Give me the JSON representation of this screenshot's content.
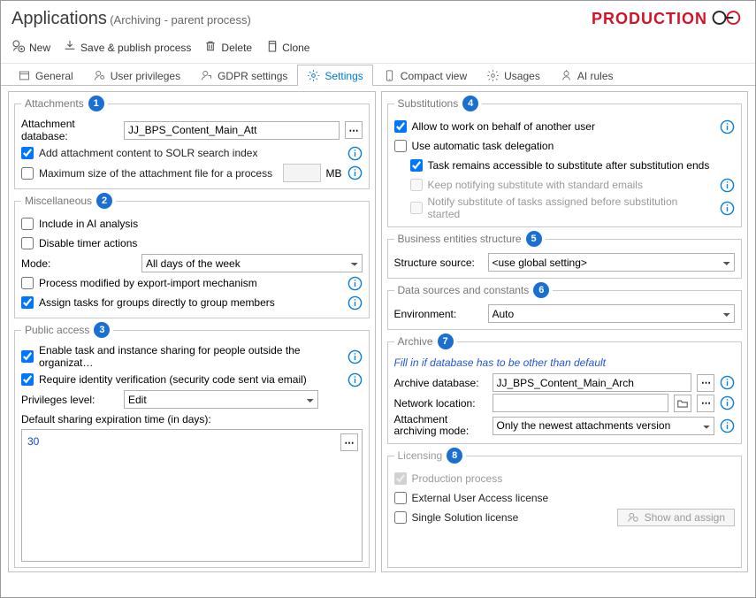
{
  "header": {
    "title": "Applications",
    "subtitle": "(Archiving - parent process)",
    "brand": "PRODUCTION"
  },
  "toolbar": {
    "new": "New",
    "save": "Save & publish process",
    "delete": "Delete",
    "clone": "Clone"
  },
  "tabs": {
    "general": "General",
    "user_priv": "User privileges",
    "gdpr": "GDPR settings",
    "settings": "Settings",
    "compact": "Compact view",
    "usages": "Usages",
    "ai": "AI rules"
  },
  "attachments": {
    "legend": "Attachments",
    "db_label": "Attachment database:",
    "db_value": "JJ_BPS_Content_Main_Att",
    "solr": "Add attachment content to SOLR search index",
    "maxsize": "Maximum size of the attachment file for a process",
    "mb": "MB"
  },
  "misc": {
    "legend": "Miscellaneous",
    "ai": "Include in AI analysis",
    "disable_timer": "Disable timer actions",
    "mode_label": "Mode:",
    "mode_value": "All days of the week",
    "export_import": "Process modified by export-import mechanism",
    "assign_groups": "Assign tasks for groups directly to group members"
  },
  "public": {
    "legend": "Public access",
    "enable_sharing": "Enable task and instance sharing for people outside the organizat…",
    "require_identity": "Require identity verification (security code sent via email)",
    "priv_label": "Privileges level:",
    "priv_value": "Edit",
    "exp_label": "Default sharing expiration time (in days):",
    "exp_value": "30"
  },
  "subs": {
    "legend": "Substitutions",
    "allow": "Allow to work on behalf of another user",
    "auto": "Use automatic task delegation",
    "remains": "Task remains accessible to substitute after substitution ends",
    "keep": "Keep notifying substitute with standard emails",
    "notify": "Notify substitute of tasks assigned before substitution started"
  },
  "bes": {
    "legend": "Business entities structure",
    "src_label": "Structure source:",
    "src_value": "<use global setting>"
  },
  "dsc": {
    "legend": "Data sources and constants",
    "env_label": "Environment:",
    "env_value": "Auto"
  },
  "archive": {
    "legend": "Archive",
    "hint": "Fill in if database has to be other than default",
    "db_label": "Archive database:",
    "db_value": "JJ_BPS_Content_Main_Arch",
    "net_label": "Network location:",
    "mode_label": "Attachment archiving mode:",
    "mode_value": "Only the newest attachments version"
  },
  "lic": {
    "legend": "Licensing",
    "prod": "Production process",
    "ext": "External User Access license",
    "single": "Single Solution license",
    "show": "Show and assign"
  },
  "badges": {
    "b1": "1",
    "b2": "2",
    "b3": "3",
    "b4": "4",
    "b5": "5",
    "b6": "6",
    "b7": "7",
    "b8": "8"
  }
}
